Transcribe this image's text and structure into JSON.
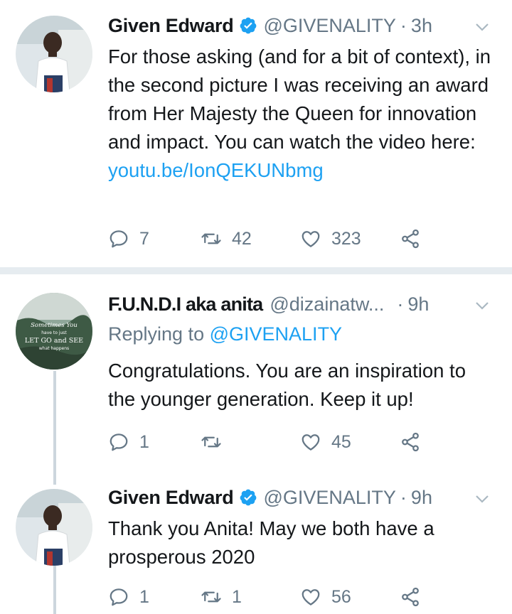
{
  "colors": {
    "link": "#1da1f2",
    "muted": "#657786",
    "verified": "#1da1f2",
    "divider": "#e6ecf0"
  },
  "tweets": [
    {
      "name": "Given Edward",
      "verified": true,
      "handle": "@GIVENALITY",
      "sep": "·",
      "time": "3h",
      "body_text": "For those asking (and for a bit of context), in the second picture I was receiving an award from Her Majesty the Queen for innovation and impact. You can watch the video here: ",
      "body_link": "youtu.be/IonQEKUNbmg",
      "replies": "7",
      "retweets": "42",
      "likes": "323",
      "avatar": "man-portrait-avatar"
    },
    {
      "name": "F.U.N.D.I aka anita",
      "verified": false,
      "handle": "@dizainatw...",
      "sep": "·",
      "time": "9h",
      "replying_prefix": "Replying to",
      "replying_to": "@GIVENALITY",
      "body_text": "Congratulations. You are an inspiration to the younger generation. Keep it up!",
      "replies": "1",
      "retweets": "",
      "likes": "45",
      "avatar_text": [
        "Sometimes You",
        "have to just",
        "LET GO and SEE",
        "what happens"
      ]
    },
    {
      "name": "Given Edward",
      "verified": true,
      "handle": "@GIVENALITY",
      "sep": "·",
      "time": "9h",
      "body_text": "Thank you Anita! May we both have a prosperous 2020",
      "replies": "1",
      "retweets": "1",
      "likes": "56",
      "avatar": "man-portrait-avatar"
    }
  ]
}
